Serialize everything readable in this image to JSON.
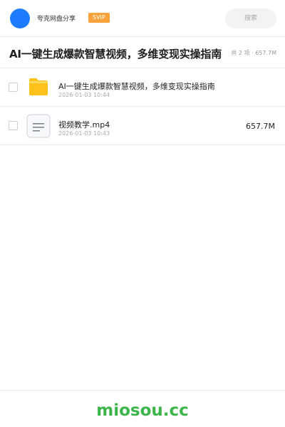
{
  "header": {
    "brand_name": "夸克网盘分享",
    "badge": "SVIP",
    "search_placeholder": "搜索"
  },
  "share": {
    "title": "AI一键生成爆款智慧视频，多维变现实操指南",
    "summary": "共 2 项 · 657.7M"
  },
  "files": [
    {
      "type": "folder",
      "name": "AI一键生成爆款智慧视频，多维变现实操指南",
      "date": "2026-01-03 10:44",
      "size": ""
    },
    {
      "type": "video",
      "name": "视频教学.mp4",
      "date": "2026-01-03 10:43",
      "size": "657.7M"
    }
  ],
  "footer": {
    "watermark": "miosou.cc"
  },
  "colors": {
    "avatar": "#1d7bff",
    "badge": "#f7a23b",
    "folder": "#ffc21a",
    "watermark": "#3cb54a"
  }
}
